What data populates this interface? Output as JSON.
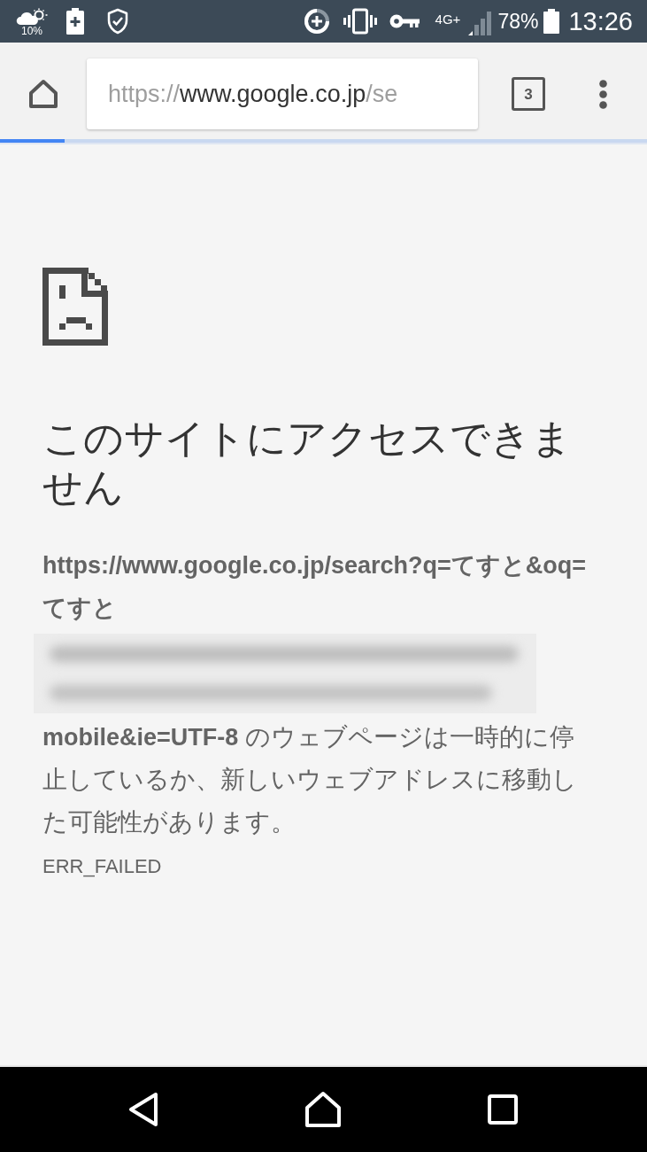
{
  "status_bar": {
    "weather_reading": "10%",
    "network": "4G+",
    "battery": "78%",
    "time": "13:26"
  },
  "toolbar": {
    "url": {
      "scheme": "https://",
      "host": "www.google.co.jp",
      "path": "/se"
    },
    "tab_count": "3"
  },
  "page_load": {
    "level": 0.1
  },
  "error": {
    "title": "このサイトにアクセスできません",
    "url": "https://www.google.co.jp/search?q=てすと&oq=てすと",
    "message": "**mobile&ie=UTF-8** のウェブページは一時的に停止しているか、新しいウェブアドレスに移動した可能性があります。",
    "code": "ERR_FAILED"
  }
}
